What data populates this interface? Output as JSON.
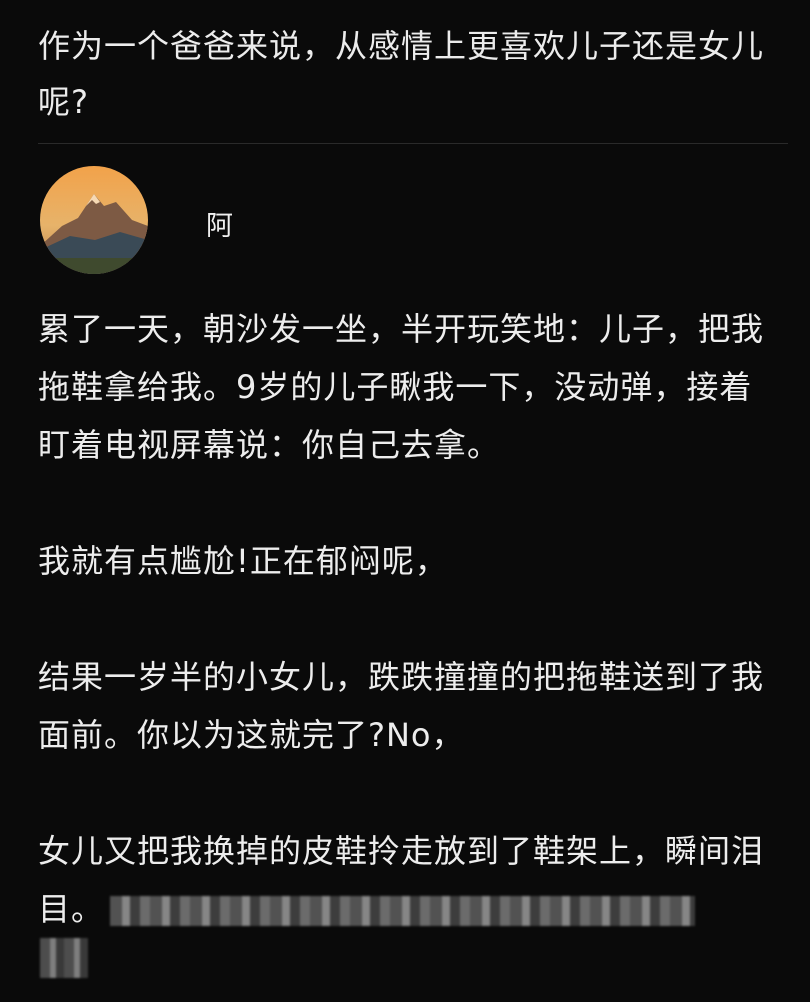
{
  "question": {
    "title": "作为一个爸爸来说，从感情上更喜欢儿子还是女儿呢?"
  },
  "author": {
    "name": "阿"
  },
  "answer": {
    "paragraphs": [
      "累了一天，朝沙发一坐，半开玩笑地：儿子，把我拖鞋拿给我。9岁的儿子瞅我一下，没动弹，接着盯着电视屏幕说：你自己去拿。",
      "我就有点尴尬!正在郁闷呢，",
      "结果一岁半的小女儿，跌跌撞撞的把拖鞋送到了我面前。你以为这就完了?No，",
      "女儿又把我换掉的皮鞋拎走放到了鞋架上，瞬间泪目。"
    ]
  }
}
